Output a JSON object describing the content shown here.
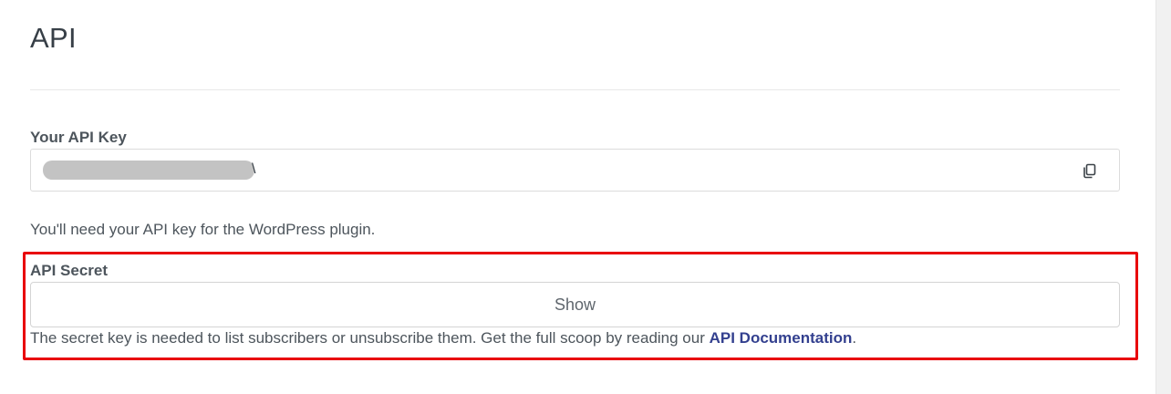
{
  "page": {
    "title": "API"
  },
  "api_key": {
    "label": "Your API Key",
    "value_visible_suffix": "\\",
    "value_redacted": true,
    "copy_icon": "copy-icon"
  },
  "api_key_help": "You'll need your API key for the WordPress plugin.",
  "api_secret": {
    "label": "API Secret",
    "show_button_label": "Show",
    "help_prefix": "The secret key is needed to list subscribers or unsubscribe them. Get the full scoop by reading our ",
    "doc_link_label": "API Documentation",
    "help_suffix": "."
  },
  "colors": {
    "highlight": "#e8000b",
    "link": "#33408f",
    "text": "#4d555c"
  }
}
